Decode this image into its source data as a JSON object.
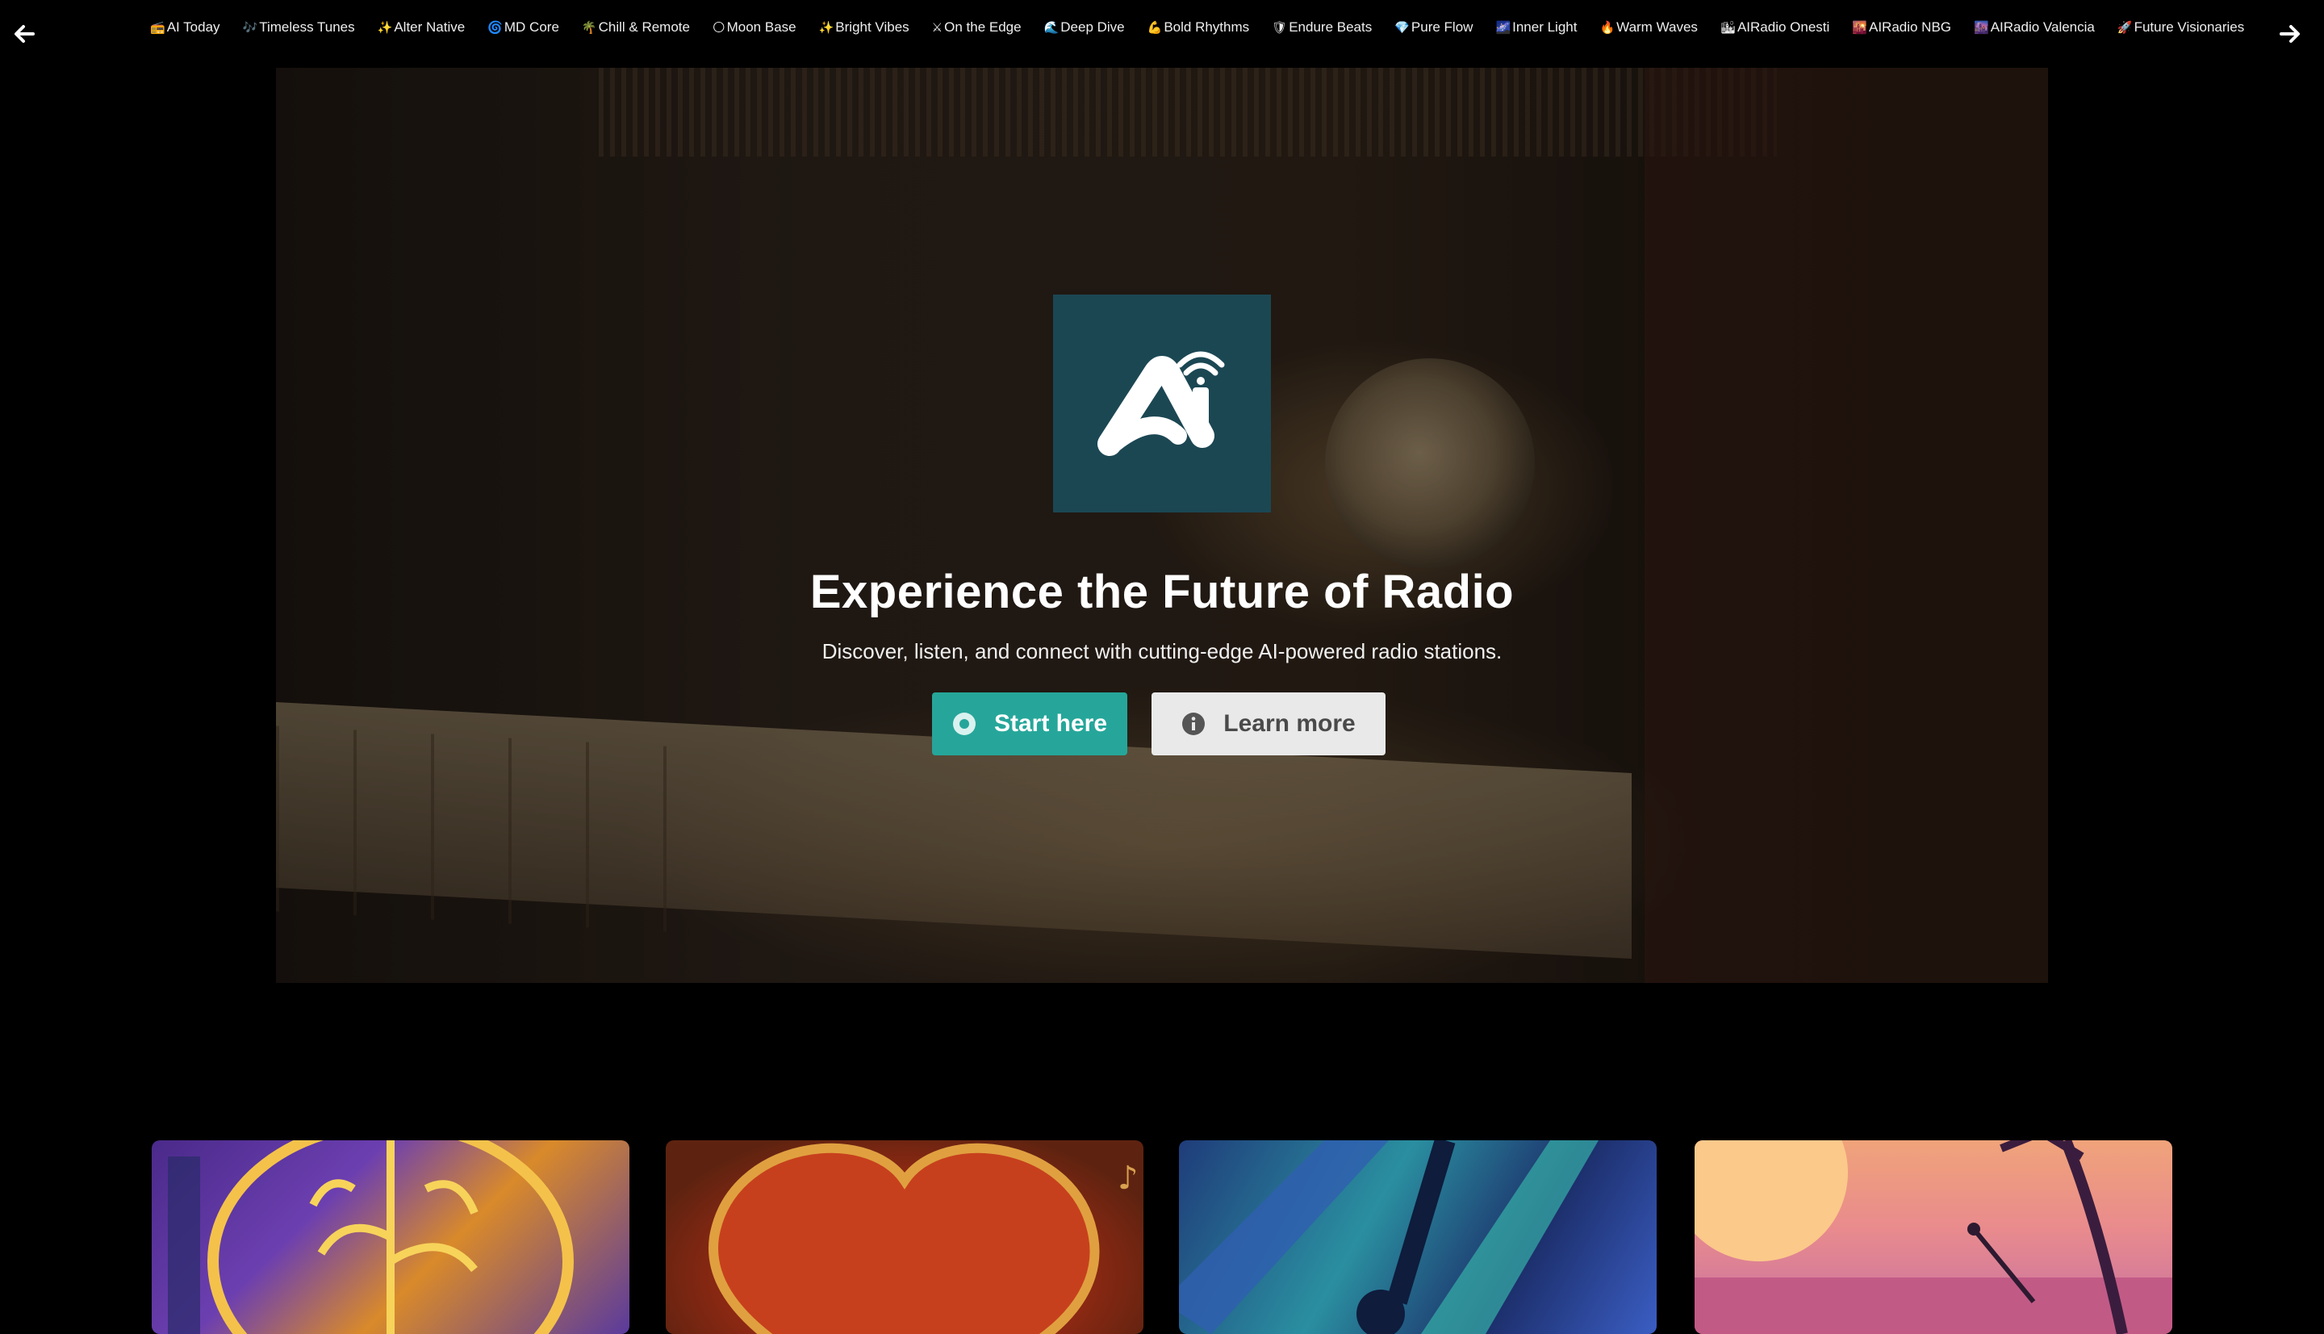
{
  "nav": {
    "prev_icon": "arrow-left-icon",
    "next_icon": "arrow-right-icon",
    "stations": [
      {
        "emoji": "📻",
        "label": "AI Today"
      },
      {
        "emoji": "🎶",
        "label": "Timeless Tunes"
      },
      {
        "emoji": "✨",
        "label": "Alter Native"
      },
      {
        "emoji": "🌀",
        "label": "MD Core"
      },
      {
        "emoji": "🌴",
        "label": "Chill & Remote"
      },
      {
        "emoji": "🌕",
        "label": "Moon Base"
      },
      {
        "emoji": "✨",
        "label": "Bright Vibes"
      },
      {
        "emoji": "⚔",
        "label": "On the Edge"
      },
      {
        "emoji": "🌊",
        "label": "Deep Dive"
      },
      {
        "emoji": "💪",
        "label": "Bold Rhythms"
      },
      {
        "emoji": "🛡",
        "label": "Endure Beats"
      },
      {
        "emoji": "💎",
        "label": "Pure Flow"
      },
      {
        "emoji": "🌌",
        "label": "Inner Light"
      },
      {
        "emoji": "🔥",
        "label": "Warm Waves"
      },
      {
        "emoji": "🏙",
        "label": "AIRadio Onesti"
      },
      {
        "emoji": "🌇",
        "label": "AIRadio NBG"
      },
      {
        "emoji": "🌆",
        "label": "AIRadio Valencia"
      },
      {
        "emoji": "🚀",
        "label": "Future Visionaries"
      }
    ]
  },
  "hero": {
    "logo_icon": "ai-radio-logo",
    "title": "Experience the Future of Radio",
    "subtitle": "Discover, listen, and connect with cutting-edge AI-powered radio stations.",
    "start_label": "Start here",
    "learn_label": "Learn more"
  },
  "colors": {
    "accent": "#26a69a",
    "logo_bg": "#1b4753",
    "secondary_button": "#e9e9e9"
  },
  "cards": [
    {
      "image": "brain-circuit-artwork"
    },
    {
      "image": "heart-music-artwork"
    },
    {
      "image": "guitar-abstract-artwork"
    },
    {
      "image": "sunset-beach-radio-artwork"
    }
  ]
}
